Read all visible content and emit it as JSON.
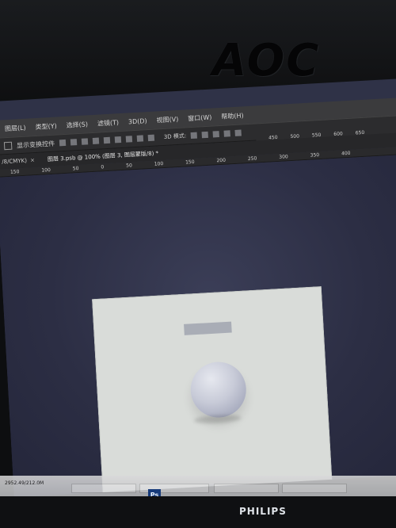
{
  "bezel": {
    "brand_top": "AOC",
    "brand_bottom": "PHILIPS"
  },
  "menu": {
    "items": [
      "图层(L)",
      "类型(Y)",
      "选择(S)",
      "滤镜(T)",
      "3D(D)",
      "视图(V)",
      "窗口(W)",
      "帮助(H)"
    ]
  },
  "options": {
    "show_transform_label": "显示变换控件",
    "mode_label": "3D 模式:",
    "ruler_right": [
      "450",
      "500",
      "550",
      "600",
      "650"
    ]
  },
  "tabs": {
    "left_tab": "/8/CMYK)",
    "active_tab": "图层 3.psb @ 100% (图层 3, 图层蒙版/8) *"
  },
  "rulers": {
    "top_left_ticks": [
      "150",
      "100",
      "50",
      "0",
      "50",
      "100",
      "150",
      "200",
      "250",
      "300",
      "350",
      "400"
    ]
  },
  "taskbar": {
    "left_text": "2952.49/212.0M",
    "ps_label": "Ps"
  }
}
